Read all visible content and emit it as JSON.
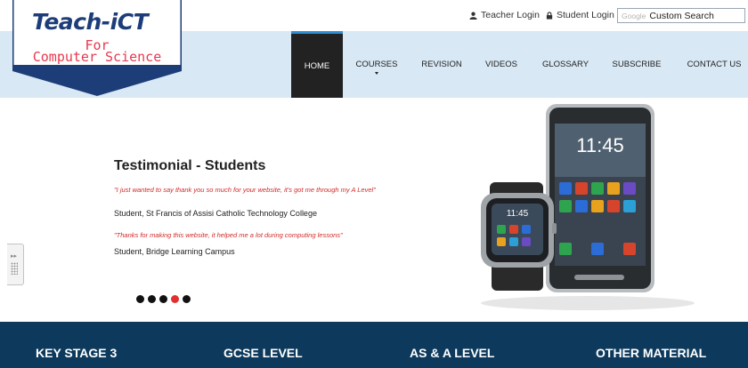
{
  "header": {
    "teacher_login": "Teacher Login",
    "student_login": "Student Login",
    "search_brand": "Google",
    "search_placeholder": "Custom Search"
  },
  "logo": {
    "line1": "Teach-iCT",
    "line2": "For",
    "line3": "Computer Science"
  },
  "nav": {
    "home": "HOME",
    "courses": "COURSES",
    "revision": "REVISION",
    "videos": "VIDEOS",
    "glossary": "GLOSSARY",
    "subscribe": "SUBSCRIBE",
    "contact": "CONTACT US"
  },
  "hero": {
    "title": "Testimonial - Students",
    "quote1": "\"I just wanted to say thank you so much for your website, it's got me through my A Level\"",
    "author1": "Student, St Francis of Assisi Catholic Technology College",
    "quote2": "\"Thanks for making this website, it helped me a lot during computing lessons\"",
    "author2": "Student, Bridge Learning Campus",
    "phone_time": "11:45",
    "watch_time": "11:45",
    "slide_count": 5,
    "active_slide": 4
  },
  "colors": {
    "nav_band": "#d8e8f4",
    "logo_blue": "#1d3d78",
    "logo_red": "#e8384f",
    "footer": "#0d3a5c",
    "quote_red": "#d22a2a",
    "active_dot": "#e0302f"
  },
  "footer": {
    "ks3": "KEY STAGE 3",
    "gcse": "GCSE LEVEL",
    "alevel": "AS & A LEVEL",
    "other": "OTHER MATERIAL"
  }
}
